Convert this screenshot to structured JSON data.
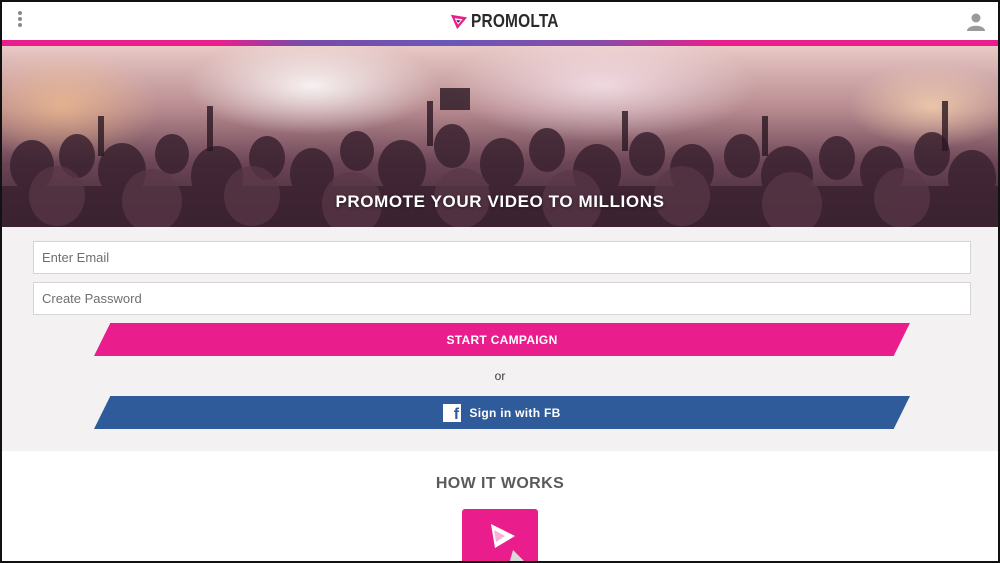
{
  "header": {
    "brand": "PROMOLTA",
    "icons": {
      "menu": "vertical-dots-icon",
      "logo": "promolta-logo-icon",
      "user": "user-icon"
    },
    "colors": {
      "brand_pink": "#e91e8c",
      "brand_blue": "#2f5b9a"
    }
  },
  "hero": {
    "title": "PROMOTE YOUR VIDEO TO MILLIONS"
  },
  "form": {
    "email_placeholder": "Enter Email",
    "email_value": "",
    "password_placeholder": "Create Password",
    "password_value": "",
    "start_campaign_label": "START CAMPAIGN",
    "or_label": "or",
    "fb_label": "Sign in with FB",
    "fb_icon": "facebook-icon"
  },
  "how_it_works": {
    "title": "HOW IT WORKS",
    "icon": "play-video-icon"
  }
}
